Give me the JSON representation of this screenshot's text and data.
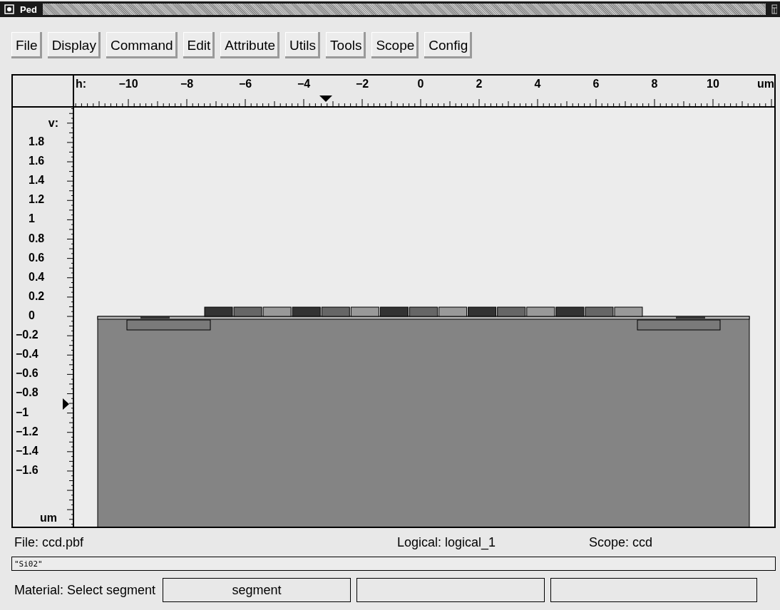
{
  "window": {
    "title": "Ped"
  },
  "menu": [
    {
      "label": "File"
    },
    {
      "label": "Display"
    },
    {
      "label": "Command"
    },
    {
      "label": "Edit"
    },
    {
      "label": "Attribute"
    },
    {
      "label": "Utils"
    },
    {
      "label": "Tools"
    },
    {
      "label": "Scope"
    },
    {
      "label": "Config"
    }
  ],
  "ruler": {
    "h_label": "h:",
    "h_unit": "um",
    "h_ticks": [
      "−10",
      "−8",
      "−6",
      "−4",
      "−2",
      "0",
      "2",
      "4",
      "6",
      "8",
      "10"
    ],
    "v_label": "v:",
    "v_unit": "um",
    "v_ticks": [
      "1.8",
      "1.6",
      "1.4",
      "1.2",
      "1",
      "0.8",
      "0.6",
      "0.4",
      "0.2",
      "0",
      "−0.2",
      "−0.4",
      "−0.6",
      "−0.8",
      "−1",
      "−1.2",
      "−1.4",
      "−1.6"
    ]
  },
  "status": {
    "file": "File: ccd.pbf",
    "logical": "Logical: logical_1",
    "scope": "Scope: ccd"
  },
  "input": {
    "value": "\"Si02\""
  },
  "prompt": {
    "label": "Material: Select segment",
    "slot": "segment"
  }
}
